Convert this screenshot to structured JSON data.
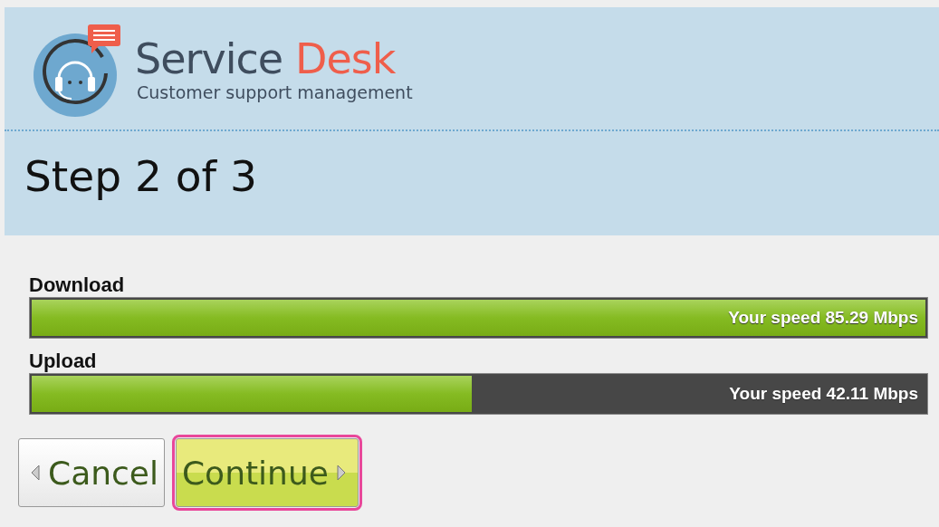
{
  "brand": {
    "name": "Service",
    "accent": "Desk",
    "tagline": "Customer support management"
  },
  "title": "Step 2 of 3",
  "meters": [
    {
      "label": "Download",
      "level": 1.0,
      "reading": "Your speed 85.29 Mbps"
    },
    {
      "label": "Upload",
      "level": 0.49,
      "reading": "Your speed 42.11 Mbps"
    }
  ],
  "buttons": [
    {
      "label": "Cancel",
      "kind": "back",
      "focused": false
    },
    {
      "label": "Continue",
      "kind": "next",
      "focused": true
    }
  ]
}
